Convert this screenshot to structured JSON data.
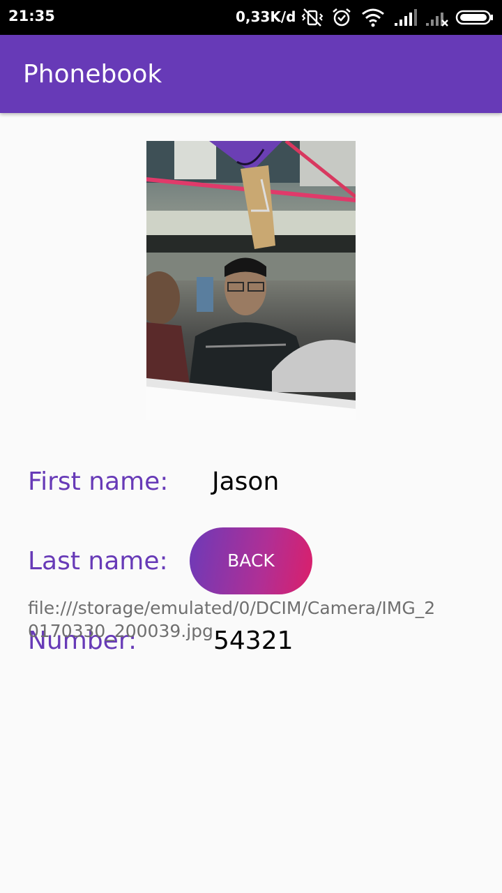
{
  "status_bar": {
    "time": "21:35",
    "net_speed": "0,33K/d",
    "icons": [
      "vibrate-off-icon",
      "alarm-icon",
      "wifi-icon",
      "signal-icon",
      "signal-no-sim-icon",
      "battery-icon"
    ]
  },
  "app_bar": {
    "title": "Phonebook",
    "color": "#673ab7"
  },
  "contact": {
    "photo_icon": "contact-photo",
    "first_name_label": "First name:",
    "first_name": "Jason",
    "last_name_label": "Last name:",
    "back_button": "BACK",
    "photo_uri": "file:///storage/emulated/0/DCIM/Camera/IMG_20170330_200039.jpg",
    "number_label": "Number:",
    "number": "54321"
  }
}
